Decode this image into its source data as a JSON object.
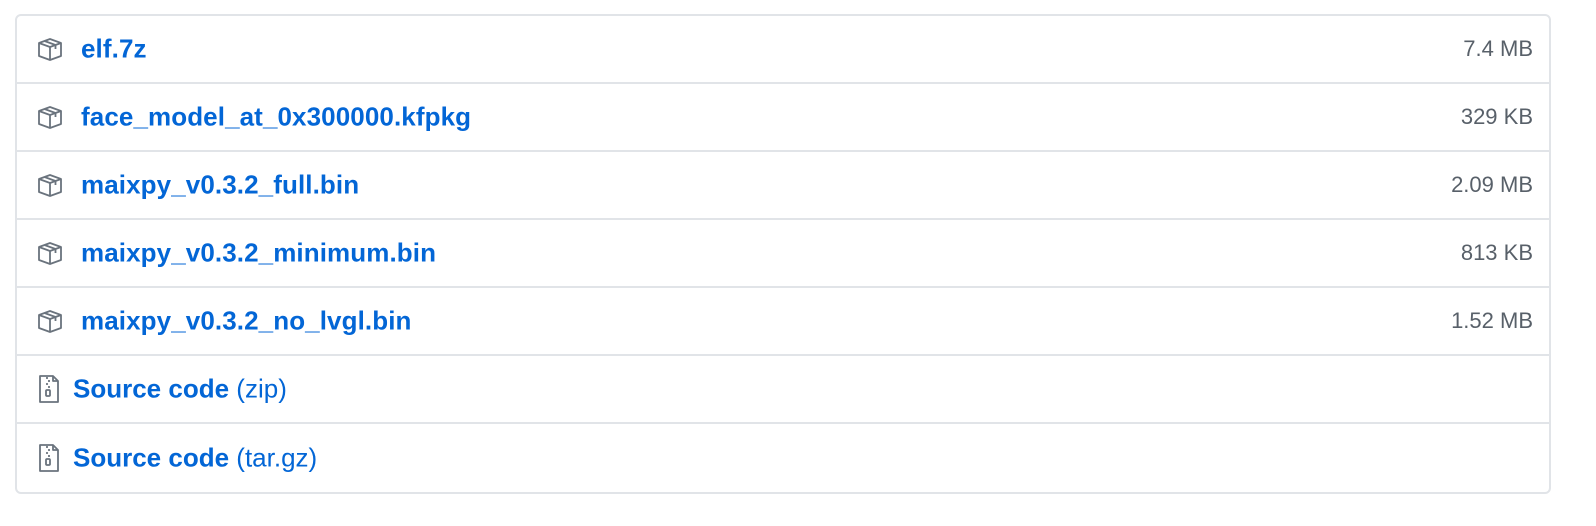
{
  "assets": [
    {
      "name": "elf.7z",
      "size": "7.4 MB",
      "icon": "package-icon"
    },
    {
      "name": "face_model_at_0x300000.kfpkg",
      "size": "329 KB",
      "icon": "package-icon"
    },
    {
      "name": "maixpy_v0.3.2_full.bin",
      "size": "2.09 MB",
      "icon": "package-icon"
    },
    {
      "name": "maixpy_v0.3.2_minimum.bin",
      "size": "813 KB",
      "icon": "package-icon"
    },
    {
      "name": "maixpy_v0.3.2_no_lvgl.bin",
      "size": "1.52 MB",
      "icon": "package-icon"
    }
  ],
  "source_code": [
    {
      "label": "Source code",
      "format": "(zip)",
      "icon": "file-zip-icon"
    },
    {
      "label": "Source code",
      "format": "(tar.gz)",
      "icon": "file-zip-icon"
    }
  ],
  "colors": {
    "link": "#0366d6",
    "muted": "#586069",
    "border": "#e1e4e8",
    "icon": "#6a737d"
  }
}
